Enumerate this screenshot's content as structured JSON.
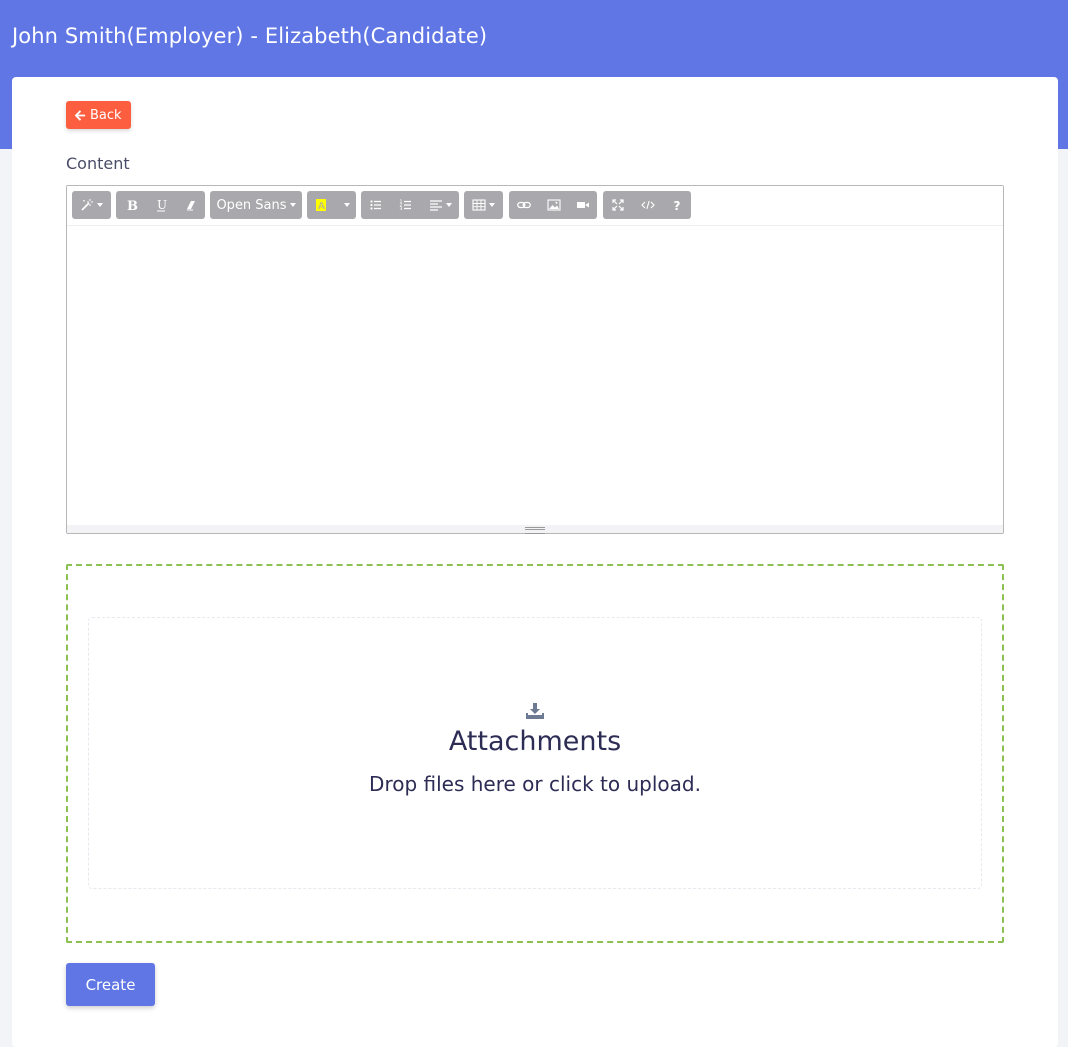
{
  "header": {
    "title": "John Smith(Employer) - Elizabeth(Candidate)"
  },
  "actions": {
    "back_label": "Back",
    "create_label": "Create"
  },
  "editor": {
    "label": "Content",
    "font_name": "Open Sans",
    "content": "",
    "toolbar_icons": [
      "magic-style-icon",
      "bold-icon",
      "underline-icon",
      "eraser-icon",
      "font-name-dropdown",
      "text-color-icon",
      "unordered-list-icon",
      "ordered-list-icon",
      "align-icon",
      "table-icon",
      "link-icon",
      "image-icon",
      "video-icon",
      "fullscreen-icon",
      "code-view-icon",
      "help-icon"
    ],
    "highlight_color": "#ffff00"
  },
  "dropzone": {
    "title": "Attachments",
    "subtitle": "Drop files here or click to upload.",
    "border_color": "#8cc152"
  },
  "colors": {
    "primary": "#5f76e4",
    "back": "#fd5e3f"
  }
}
